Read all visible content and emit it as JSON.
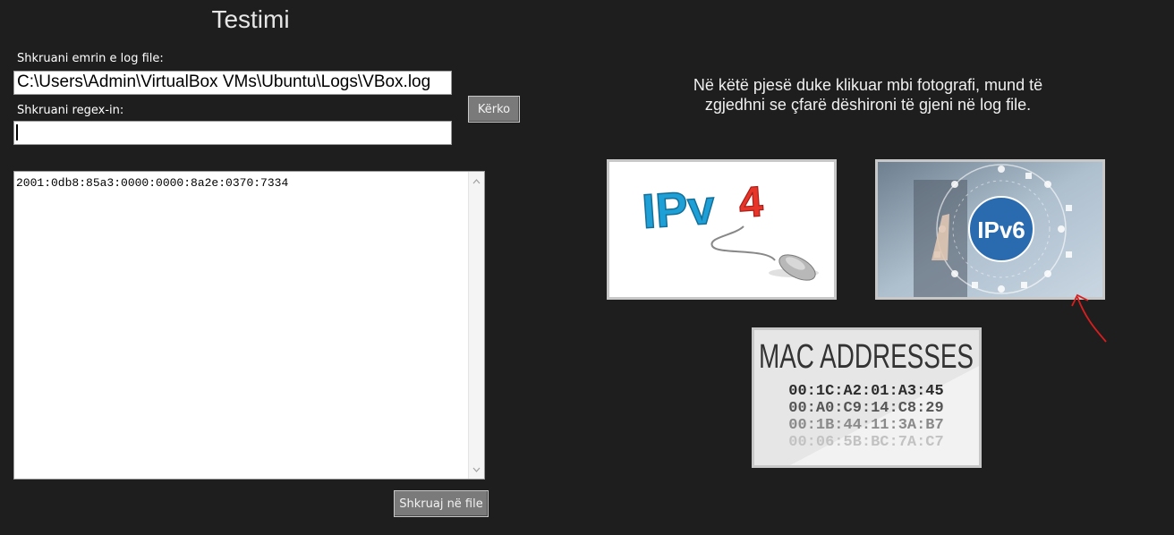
{
  "page": {
    "title": "Testimi"
  },
  "form": {
    "logfile_label": "Shkruani emrin e log file:",
    "logfile_value": "C:\\Users\\Admin\\VirtualBox VMs\\Ubuntu\\Logs\\VBox.log",
    "regex_label": "Shkruani regex-in:",
    "regex_value": "",
    "search_button": "Kërko"
  },
  "results": {
    "lines": "2001:0db8:85a3:0000:0000:8a2e:0370:7334"
  },
  "write_button": "Shkruaj në file",
  "info_text_line1": "Në këtë pjesë duke klikuar mbi fotografi, mund të",
  "info_text_line2": "zgjedhni se çfarë dëshironi të gjeni në log file.",
  "tiles": {
    "ipv4": {
      "text": "IPv4"
    },
    "ipv6": {
      "text": "IPv6"
    },
    "mac": {
      "title": "MAC ADDRESSES",
      "addresses": [
        "00:1C:A2:01:A3:45",
        "00:A0:C9:14:C8:29",
        "00:1B:44:11:3A:B7",
        "00:06:5B:BC:7A:C7"
      ]
    }
  },
  "colors": {
    "background": "#1e1e1e",
    "button": "#7a7a7a",
    "ipv4_blue": "#1e9fd6",
    "ipv4_red": "#e8352a",
    "ipv6_blue": "#2a6bb0",
    "annotation_red": "#d81e1e"
  }
}
